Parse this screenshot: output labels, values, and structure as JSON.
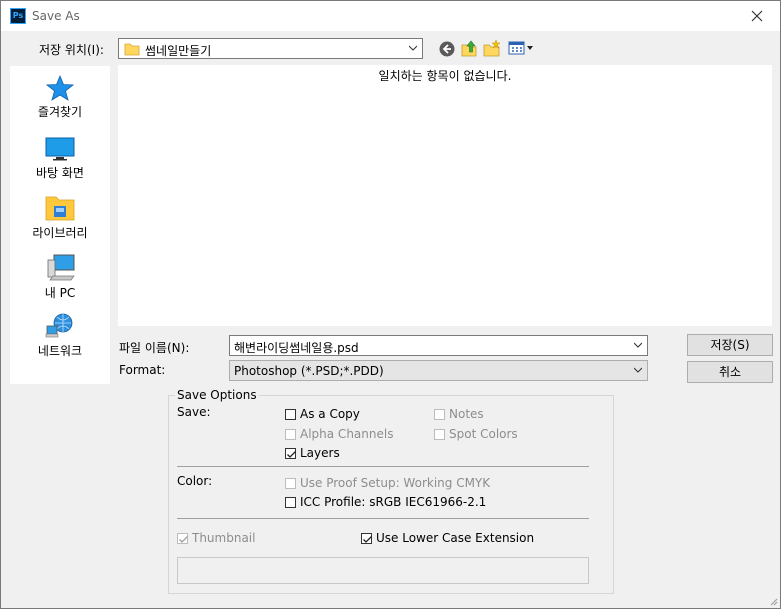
{
  "window": {
    "title": "Save As",
    "app_icon_text": "Ps"
  },
  "location": {
    "label": "저장 위치(I):",
    "value": "썸네일만들기"
  },
  "toolbar": {
    "icons": [
      "back-icon",
      "up-folder-icon",
      "new-folder-icon",
      "view-menu-icon"
    ]
  },
  "places": [
    {
      "label": "즐겨찾기",
      "icon": "star-icon"
    },
    {
      "label": "바탕 화면",
      "icon": "desktop-icon"
    },
    {
      "label": "라이브러리",
      "icon": "library-icon"
    },
    {
      "label": "내 PC",
      "icon": "computer-icon"
    },
    {
      "label": "네트워크",
      "icon": "network-icon"
    }
  ],
  "file_list": {
    "empty_message": "일치하는 항목이 없습니다."
  },
  "filename": {
    "label": "파일 이름(N):",
    "value": "해변라이딩썸네일용.psd"
  },
  "format": {
    "label": "Format:",
    "value": "Photoshop (*.PSD;*.PDD)"
  },
  "buttons": {
    "save": "저장(S)",
    "cancel": "취소"
  },
  "save_options": {
    "title": "Save Options",
    "save_label": "Save:",
    "as_a_copy": {
      "label": "As a Copy",
      "checked": false,
      "enabled": true
    },
    "notes": {
      "label": "Notes",
      "checked": false,
      "enabled": false
    },
    "alpha_channels": {
      "label": "Alpha Channels",
      "checked": false,
      "enabled": false
    },
    "spot_colors": {
      "label": "Spot Colors",
      "checked": false,
      "enabled": false
    },
    "layers": {
      "label": "Layers",
      "checked": true,
      "enabled": true
    },
    "color_label": "Color:",
    "use_proof_setup": {
      "label": "Use Proof Setup:  Working CMYK",
      "checked": false,
      "enabled": false
    },
    "icc_profile": {
      "label": "ICC Profile:  sRGB IEC61966-2.1",
      "checked": false,
      "enabled": true
    },
    "thumbnail": {
      "label": "Thumbnail",
      "checked": true,
      "enabled": false
    },
    "lower_case": {
      "label": "Use Lower Case Extension",
      "checked": true,
      "enabled": true
    }
  },
  "colors": {
    "accent": "#0078d7",
    "folder": "#ffd75e",
    "background": "#f0f0f0"
  }
}
